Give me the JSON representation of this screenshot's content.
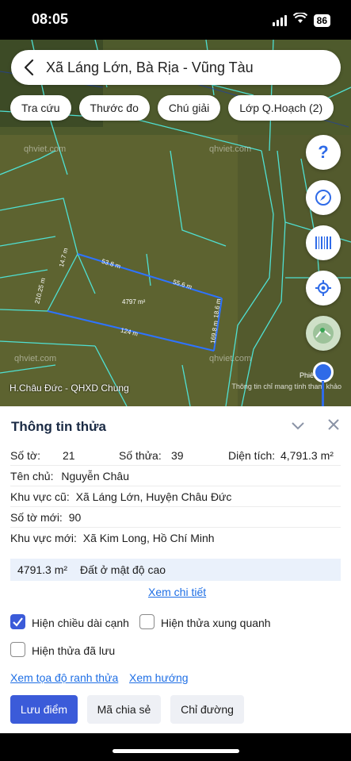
{
  "status": {
    "time": "08:05",
    "battery": "86"
  },
  "search": {
    "title": "Xã Láng Lớn, Bà Rịa - Vũng Tàu"
  },
  "chips": [
    "Tra cứu",
    "Thước đo",
    "Chú giải",
    "Lớp Q.Hoạch (2)"
  ],
  "map": {
    "watermarks": [
      "qhviet.com",
      "qhviet.com",
      "qhviet.com",
      "qhviet.com"
    ],
    "edges": [
      "53.8 m",
      "55.6 m",
      "18.6 m",
      "124 m",
      "169.8 m",
      "210.25 m",
      "14.7 m"
    ],
    "area_label": "4797 m²",
    "caption": "H.Châu Đức - QHXD Chung",
    "note": "Thông tin chỉ mang tính tham khảo",
    "zoom_label": "Phiên 12"
  },
  "panel": {
    "title": "Thông tin thửa",
    "so_to_label": "Số tờ:",
    "so_to": "21",
    "so_thua_label": "Số thửa:",
    "so_thua": "39",
    "dien_tich_label": "Diện tích:",
    "dien_tich": "4,791.3 m²",
    "ten_chu_label": "Tên chủ:",
    "ten_chu": "Nguyễn Châu",
    "kv_cu_label": "Khu vực cũ:",
    "kv_cu": "Xã Láng Lớn, Huyện Châu Đức",
    "so_to_moi_label": "Số tờ mới:",
    "so_to_moi": "90",
    "kv_moi_label": "Khu vực mới:",
    "kv_moi": "Xã Kim Long, Hồ Chí Minh",
    "summary_area": "4791.3 m²",
    "summary_type": "Đất ở mật độ cao",
    "detail_link": "Xem chi tiết",
    "checkbox_edges": "Hiện chiều dài cạnh",
    "checkbox_neighbors": "Hiện thửa xung quanh",
    "checkbox_saved": "Hiện thửa đã lưu",
    "link_coords": "Xem tọa độ ranh thửa",
    "link_direction": "Xem hướng",
    "btn_save": "Lưu điểm",
    "btn_share": "Mã chia sẻ",
    "btn_route": "Chỉ đường"
  },
  "colors": {
    "accent": "#3b5bd9",
    "link": "#1f6fe5",
    "map_bg": "#5d6330",
    "parcel": "#4aa3ff"
  }
}
